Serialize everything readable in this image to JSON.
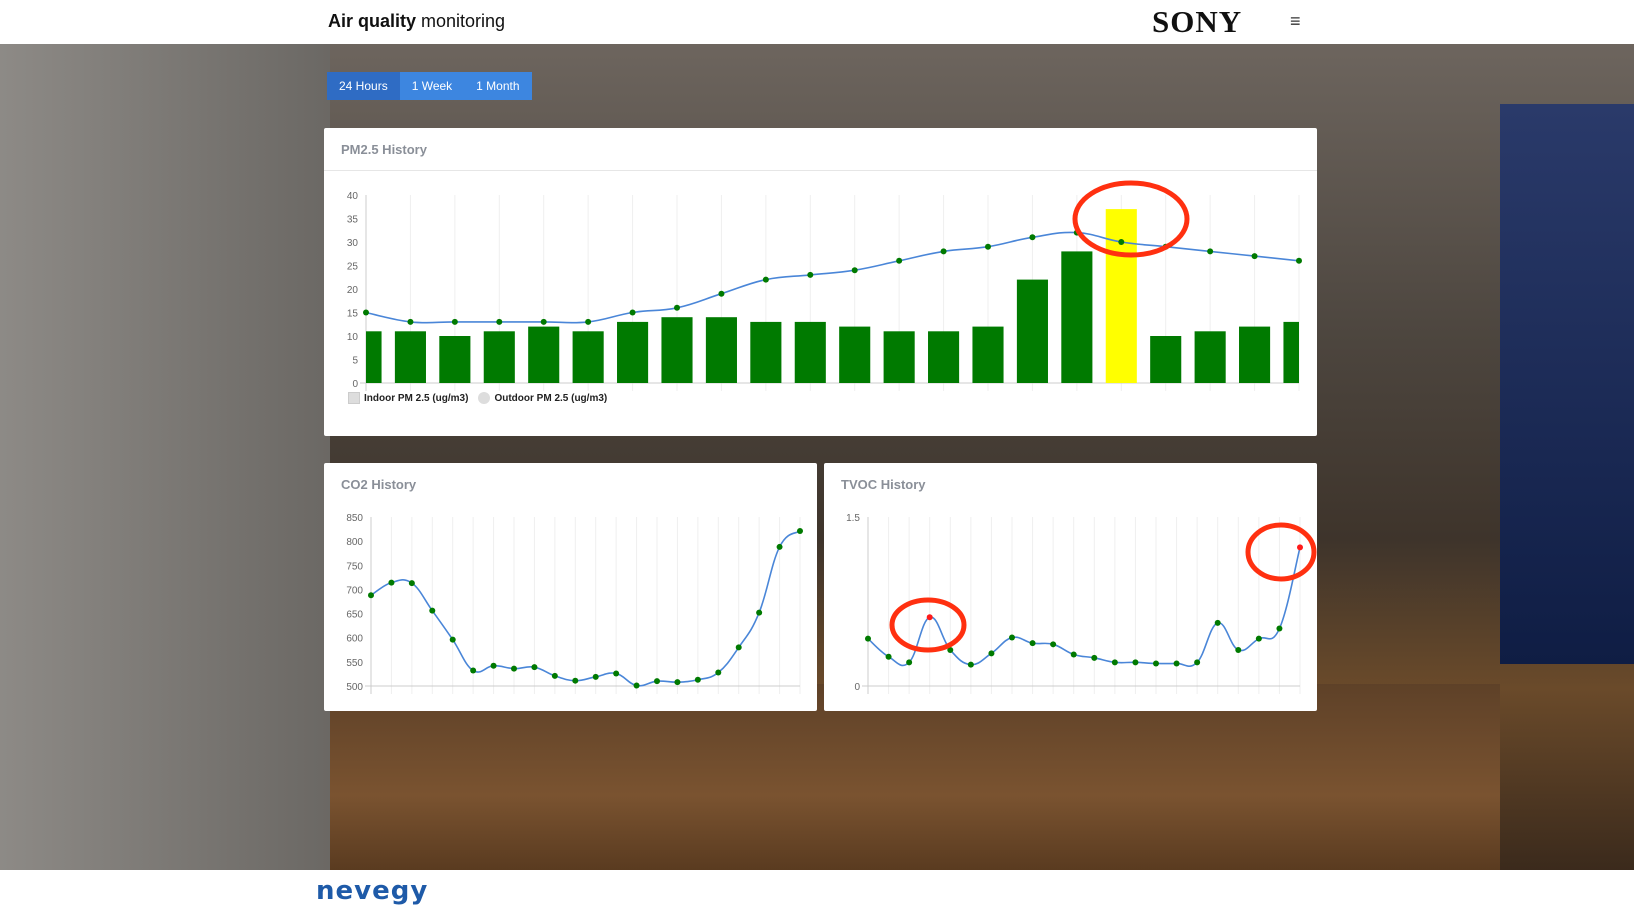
{
  "header": {
    "title_bold": "Air quality",
    "title_rest": " monitoring",
    "brand": "SONY",
    "menu_icon": "hamburger-icon"
  },
  "ranges": [
    {
      "label": "24 Hours",
      "active": true
    },
    {
      "label": "1 Week",
      "active": false
    },
    {
      "label": "1 Month",
      "active": false
    }
  ],
  "footer": {
    "logo": "nevegy"
  },
  "colors": {
    "bar": "#007a00",
    "highlight_bar": "#ffff00",
    "line": "#4a86d8",
    "point": "#007a00",
    "alert_point": "#ff1a1a",
    "annotation": "#ff3010",
    "button": "#3d86e0"
  },
  "chart_data": [
    {
      "type": "bar",
      "title": "PM2.5 History",
      "ylim": [
        0,
        40
      ],
      "yticks": [
        "0",
        "5",
        "10",
        "15",
        "20",
        "25",
        "30",
        "35",
        "40"
      ],
      "grid": true,
      "legend": "bottom-left",
      "series": [
        {
          "name": "Indoor PM 2.5 (ug/m3)",
          "type": "bar",
          "values": [
            11,
            11,
            10,
            11,
            12,
            11,
            13,
            14,
            14,
            13,
            13,
            12,
            11,
            11,
            12,
            22,
            28,
            37,
            10,
            11,
            12,
            13
          ],
          "highlight_index": 17
        },
        {
          "name": "Outdoor PM 2.5 (ug/m3)",
          "type": "line",
          "values": [
            15,
            13,
            13,
            13,
            13,
            13,
            15,
            16,
            19,
            22,
            23,
            24,
            26,
            28,
            29,
            31,
            32,
            30,
            29,
            28,
            27,
            26
          ]
        }
      ]
    },
    {
      "type": "line",
      "title": "CO2 History",
      "ylim": [
        500,
        850
      ],
      "yticks": [
        "500",
        "550",
        "600",
        "650",
        "700",
        "750",
        "800",
        "850"
      ],
      "grid": true,
      "values": [
        688,
        714,
        713,
        656,
        596,
        532,
        542,
        536,
        539,
        521,
        511,
        519,
        526,
        501,
        510,
        508,
        513,
        528,
        580,
        652,
        788,
        821
      ]
    },
    {
      "type": "line",
      "title": "TVOC History",
      "ylim": [
        0,
        1.5
      ],
      "yticks": [
        "0",
        "1.5"
      ],
      "grid": true,
      "values": [
        0.42,
        0.26,
        0.21,
        0.61,
        0.32,
        0.19,
        0.29,
        0.43,
        0.38,
        0.37,
        0.28,
        0.25,
        0.21,
        0.21,
        0.2,
        0.2,
        0.21,
        0.56,
        0.32,
        0.42,
        0.51,
        1.23
      ],
      "alert_indices": [
        3,
        21
      ]
    }
  ]
}
